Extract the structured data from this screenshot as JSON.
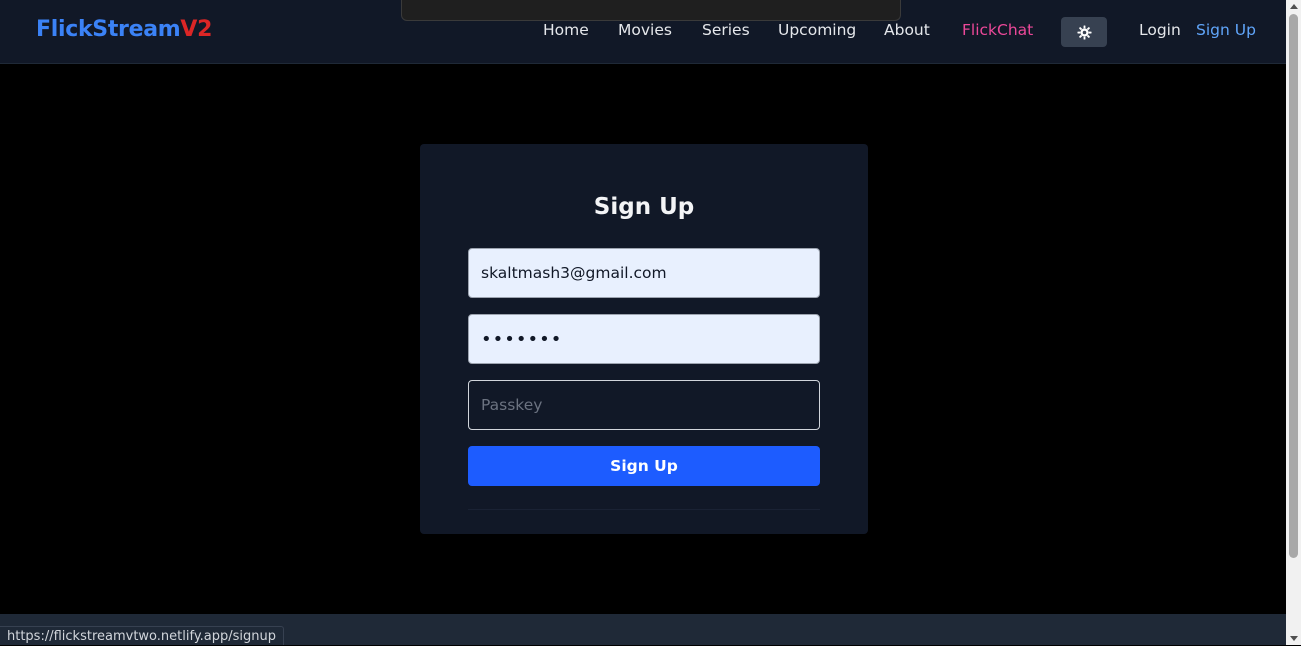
{
  "brand": {
    "part1": "FlickStream",
    "part2": "V2"
  },
  "nav": {
    "home": "Home",
    "movies": "Movies",
    "series": "Series",
    "upcoming": "Upcoming",
    "about": "About",
    "flickchat": "FlickChat",
    "theme_icon": "gear-icon",
    "login": "Login",
    "signup": "Sign Up"
  },
  "form": {
    "title": "Sign Up",
    "email_value": "skaltmash3@gmail.com",
    "password_value": "•••••••",
    "passkey_placeholder": "Passkey",
    "submit_label": "Sign Up"
  },
  "status_bar": {
    "url": "https://flickstreamvtwo.netlify.app/signup"
  },
  "colors": {
    "brand_blue": "#3b82f6",
    "brand_red": "#dc2626",
    "chat_pink": "#ec4899",
    "signup_link": "#60a5fa",
    "button_blue": "#1d5cff",
    "navbar_bg": "#111827"
  }
}
